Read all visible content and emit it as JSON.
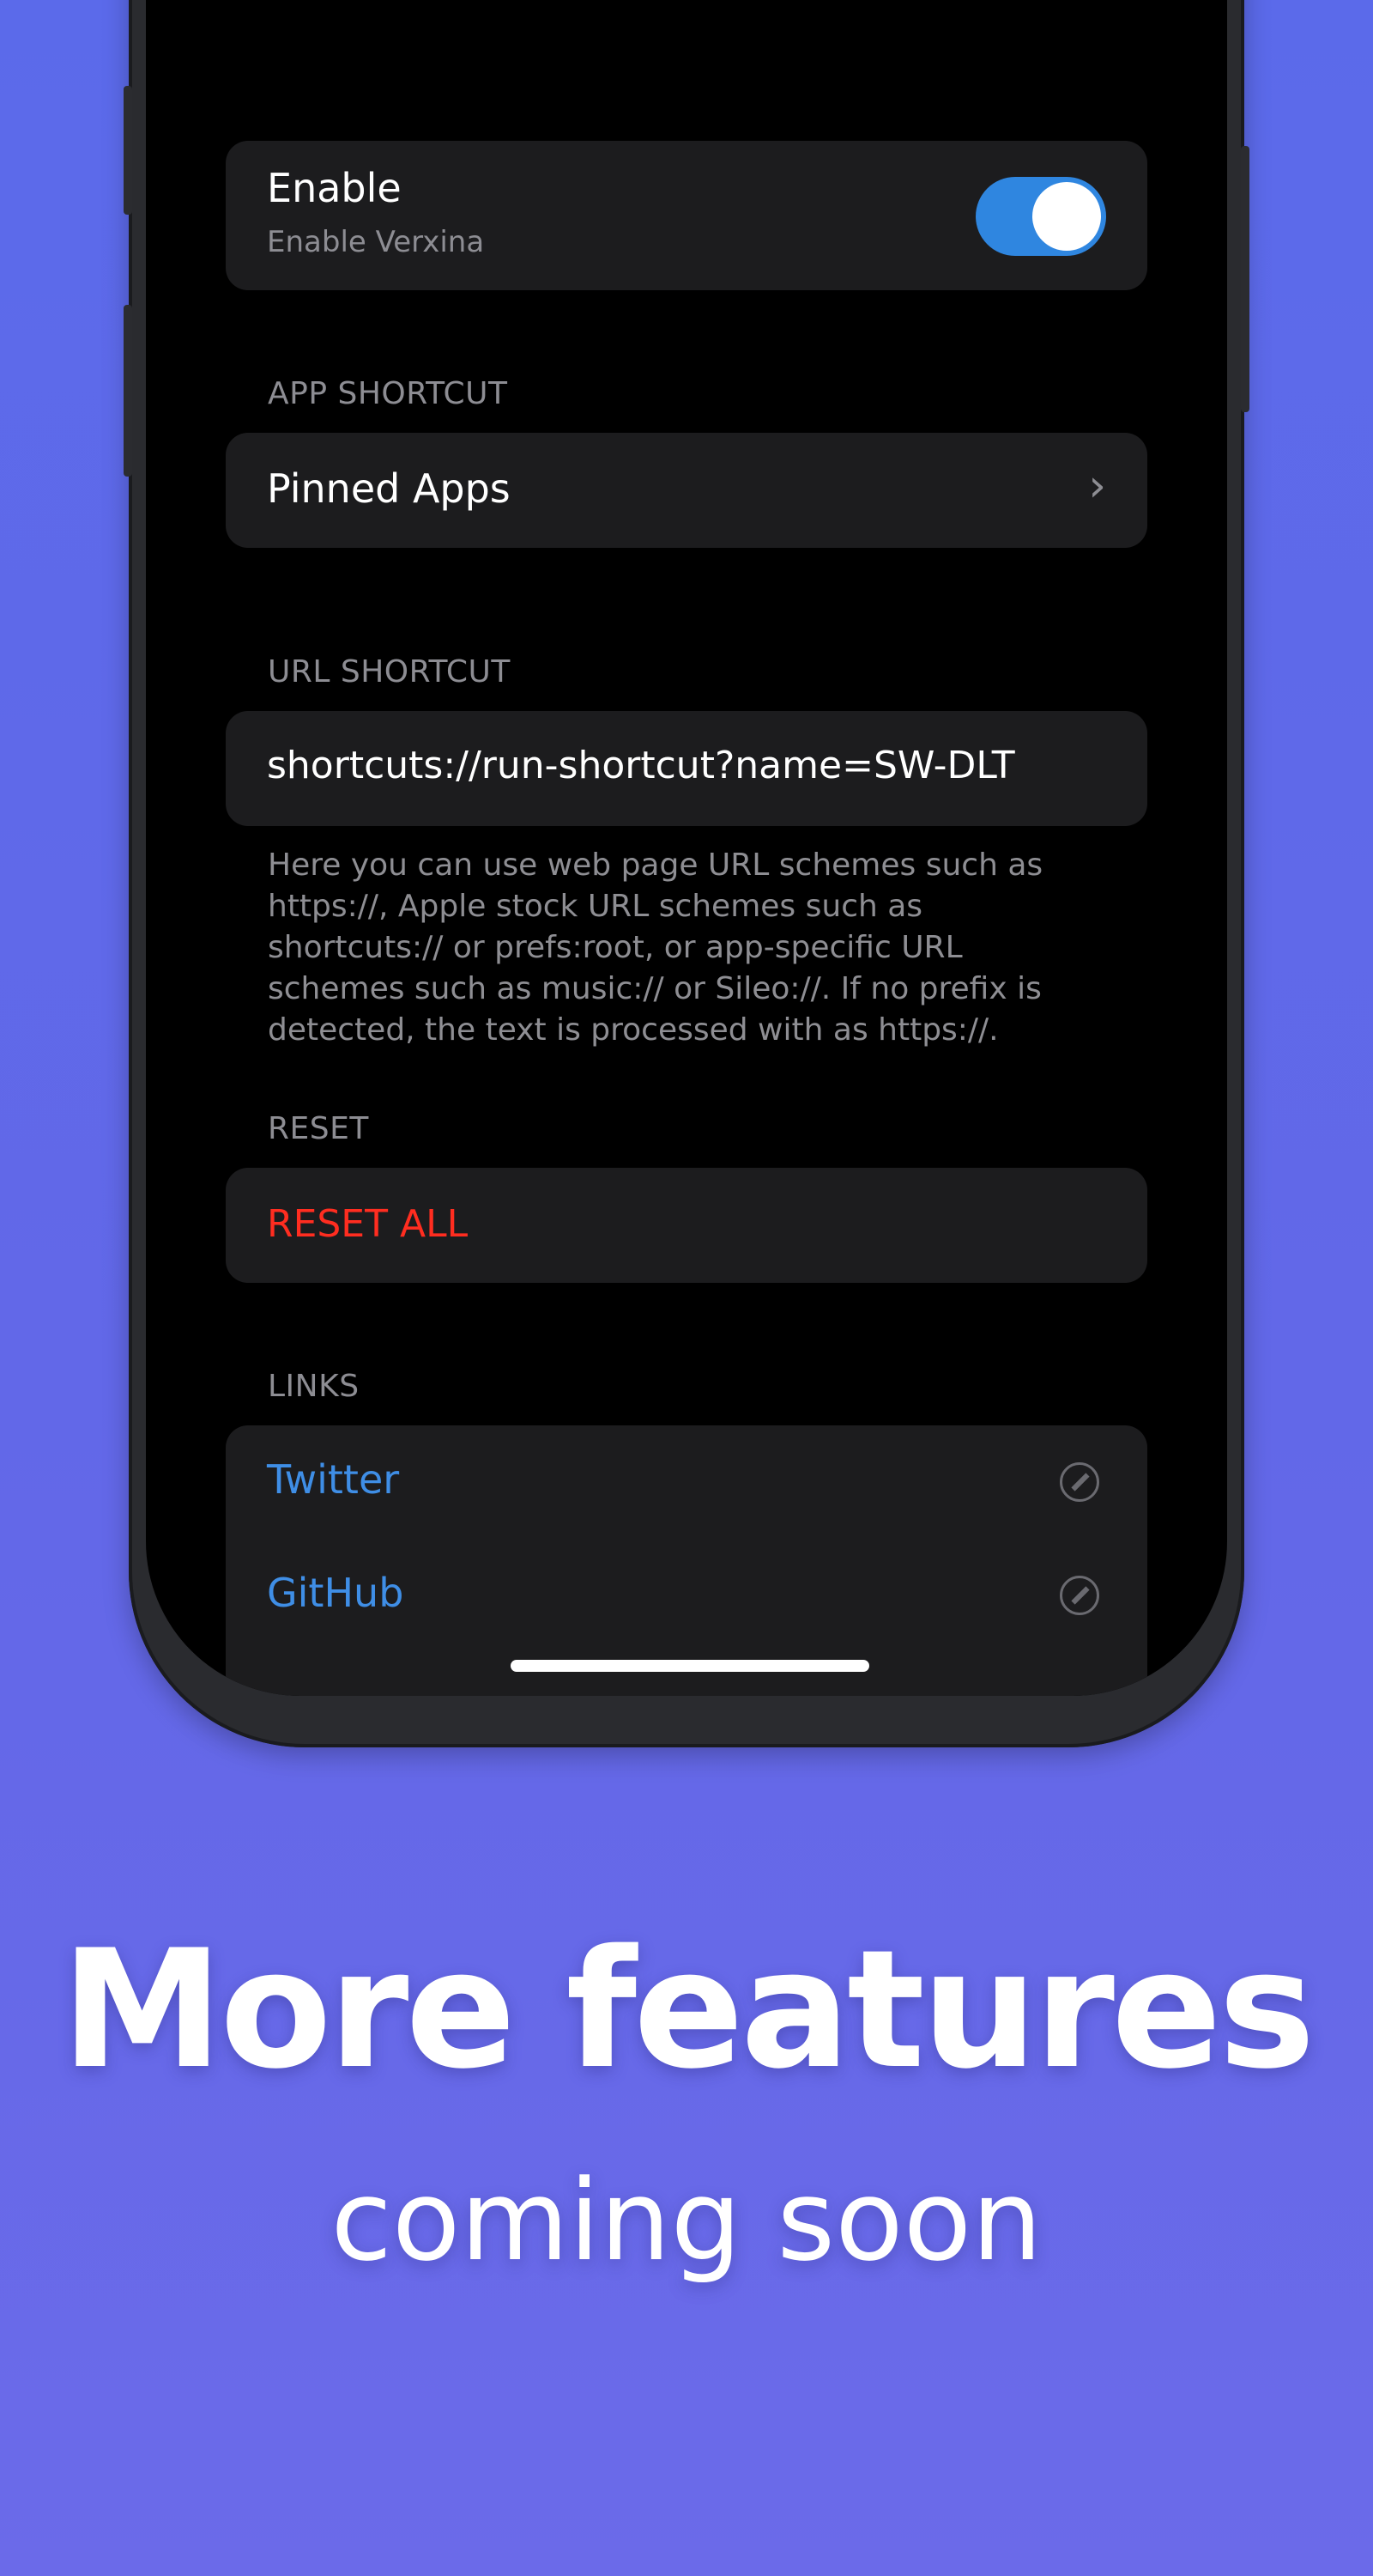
{
  "settings": {
    "enable": {
      "title": "Enable",
      "subtitle": "Enable Verxina",
      "toggle_on": true
    },
    "app_shortcut": {
      "header": "APP SHORTCUT",
      "pinned_apps_label": "Pinned Apps"
    },
    "url_shortcut": {
      "header": "URL SHORTCUT",
      "value": "shortcuts://run-shortcut?name=SW-DLT",
      "description": "Here you can use web page URL schemes such as https://, Apple stock URL schemes such as shortcuts:// or prefs:root, or app-specific URL schemes such as music:// or Sileo://. If no prefix is detected, the text is processed with as https://."
    },
    "reset": {
      "header": "RESET",
      "button_label": "RESET ALL"
    },
    "links": {
      "header": "LINKS",
      "items": [
        {
          "label": "Twitter",
          "icon": "compass-icon"
        },
        {
          "label": "GitHub",
          "icon": "compass-icon"
        }
      ]
    }
  },
  "promo": {
    "headline": "More features",
    "subheadline": "coming soon"
  },
  "colors": {
    "background": "#5b6aea",
    "toggle_on": "#2f86e0",
    "destructive": "#ff2d20",
    "link": "#3f8ee6"
  }
}
